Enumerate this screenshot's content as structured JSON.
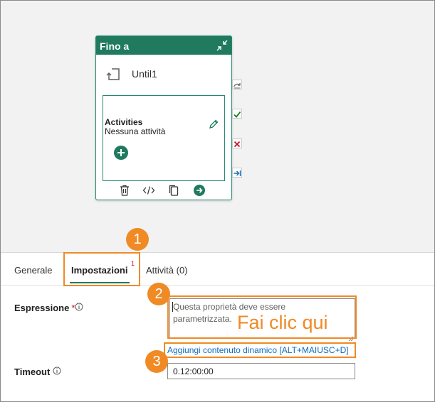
{
  "node": {
    "title": "Fino a",
    "activity_name": "Until1",
    "activities_heading": "Activities",
    "activities_empty": "Nessuna attività"
  },
  "tabs": [
    {
      "label": "Generale",
      "active": false
    },
    {
      "label": "Impostazioni",
      "active": true,
      "badge": "1"
    },
    {
      "label": "Attività (0)",
      "active": false
    }
  ],
  "callouts": [
    "1",
    "2",
    "3"
  ],
  "form": {
    "expression": {
      "label": "Espressione",
      "required_mark": "*",
      "placeholder": "Questa proprietà deve essere parametrizzata.",
      "annotation": "Fai clic qui",
      "dynamic_link": "Aggiungi contenuto dinamico [ALT+MAIUSC+D]"
    },
    "timeout": {
      "label": "Timeout",
      "value": "0.12:00:00"
    }
  },
  "icons": {
    "expand": "expand-collapse-icon",
    "until": "until-loop-icon",
    "edit": "pencil-icon",
    "add": "plus-icon",
    "delete": "trash-icon",
    "code": "code-icon",
    "copy": "copy-icon",
    "go": "arrow-right-circle-icon",
    "info": "info-icon"
  },
  "colors": {
    "accent": "#1f7a5e",
    "annotation": "#f08a24",
    "link": "#0f6cbd",
    "required": "#c50f1f",
    "port_success": "#107c10",
    "port_fail": "#c50f1f",
    "port_completion": "#0f6cbd"
  }
}
